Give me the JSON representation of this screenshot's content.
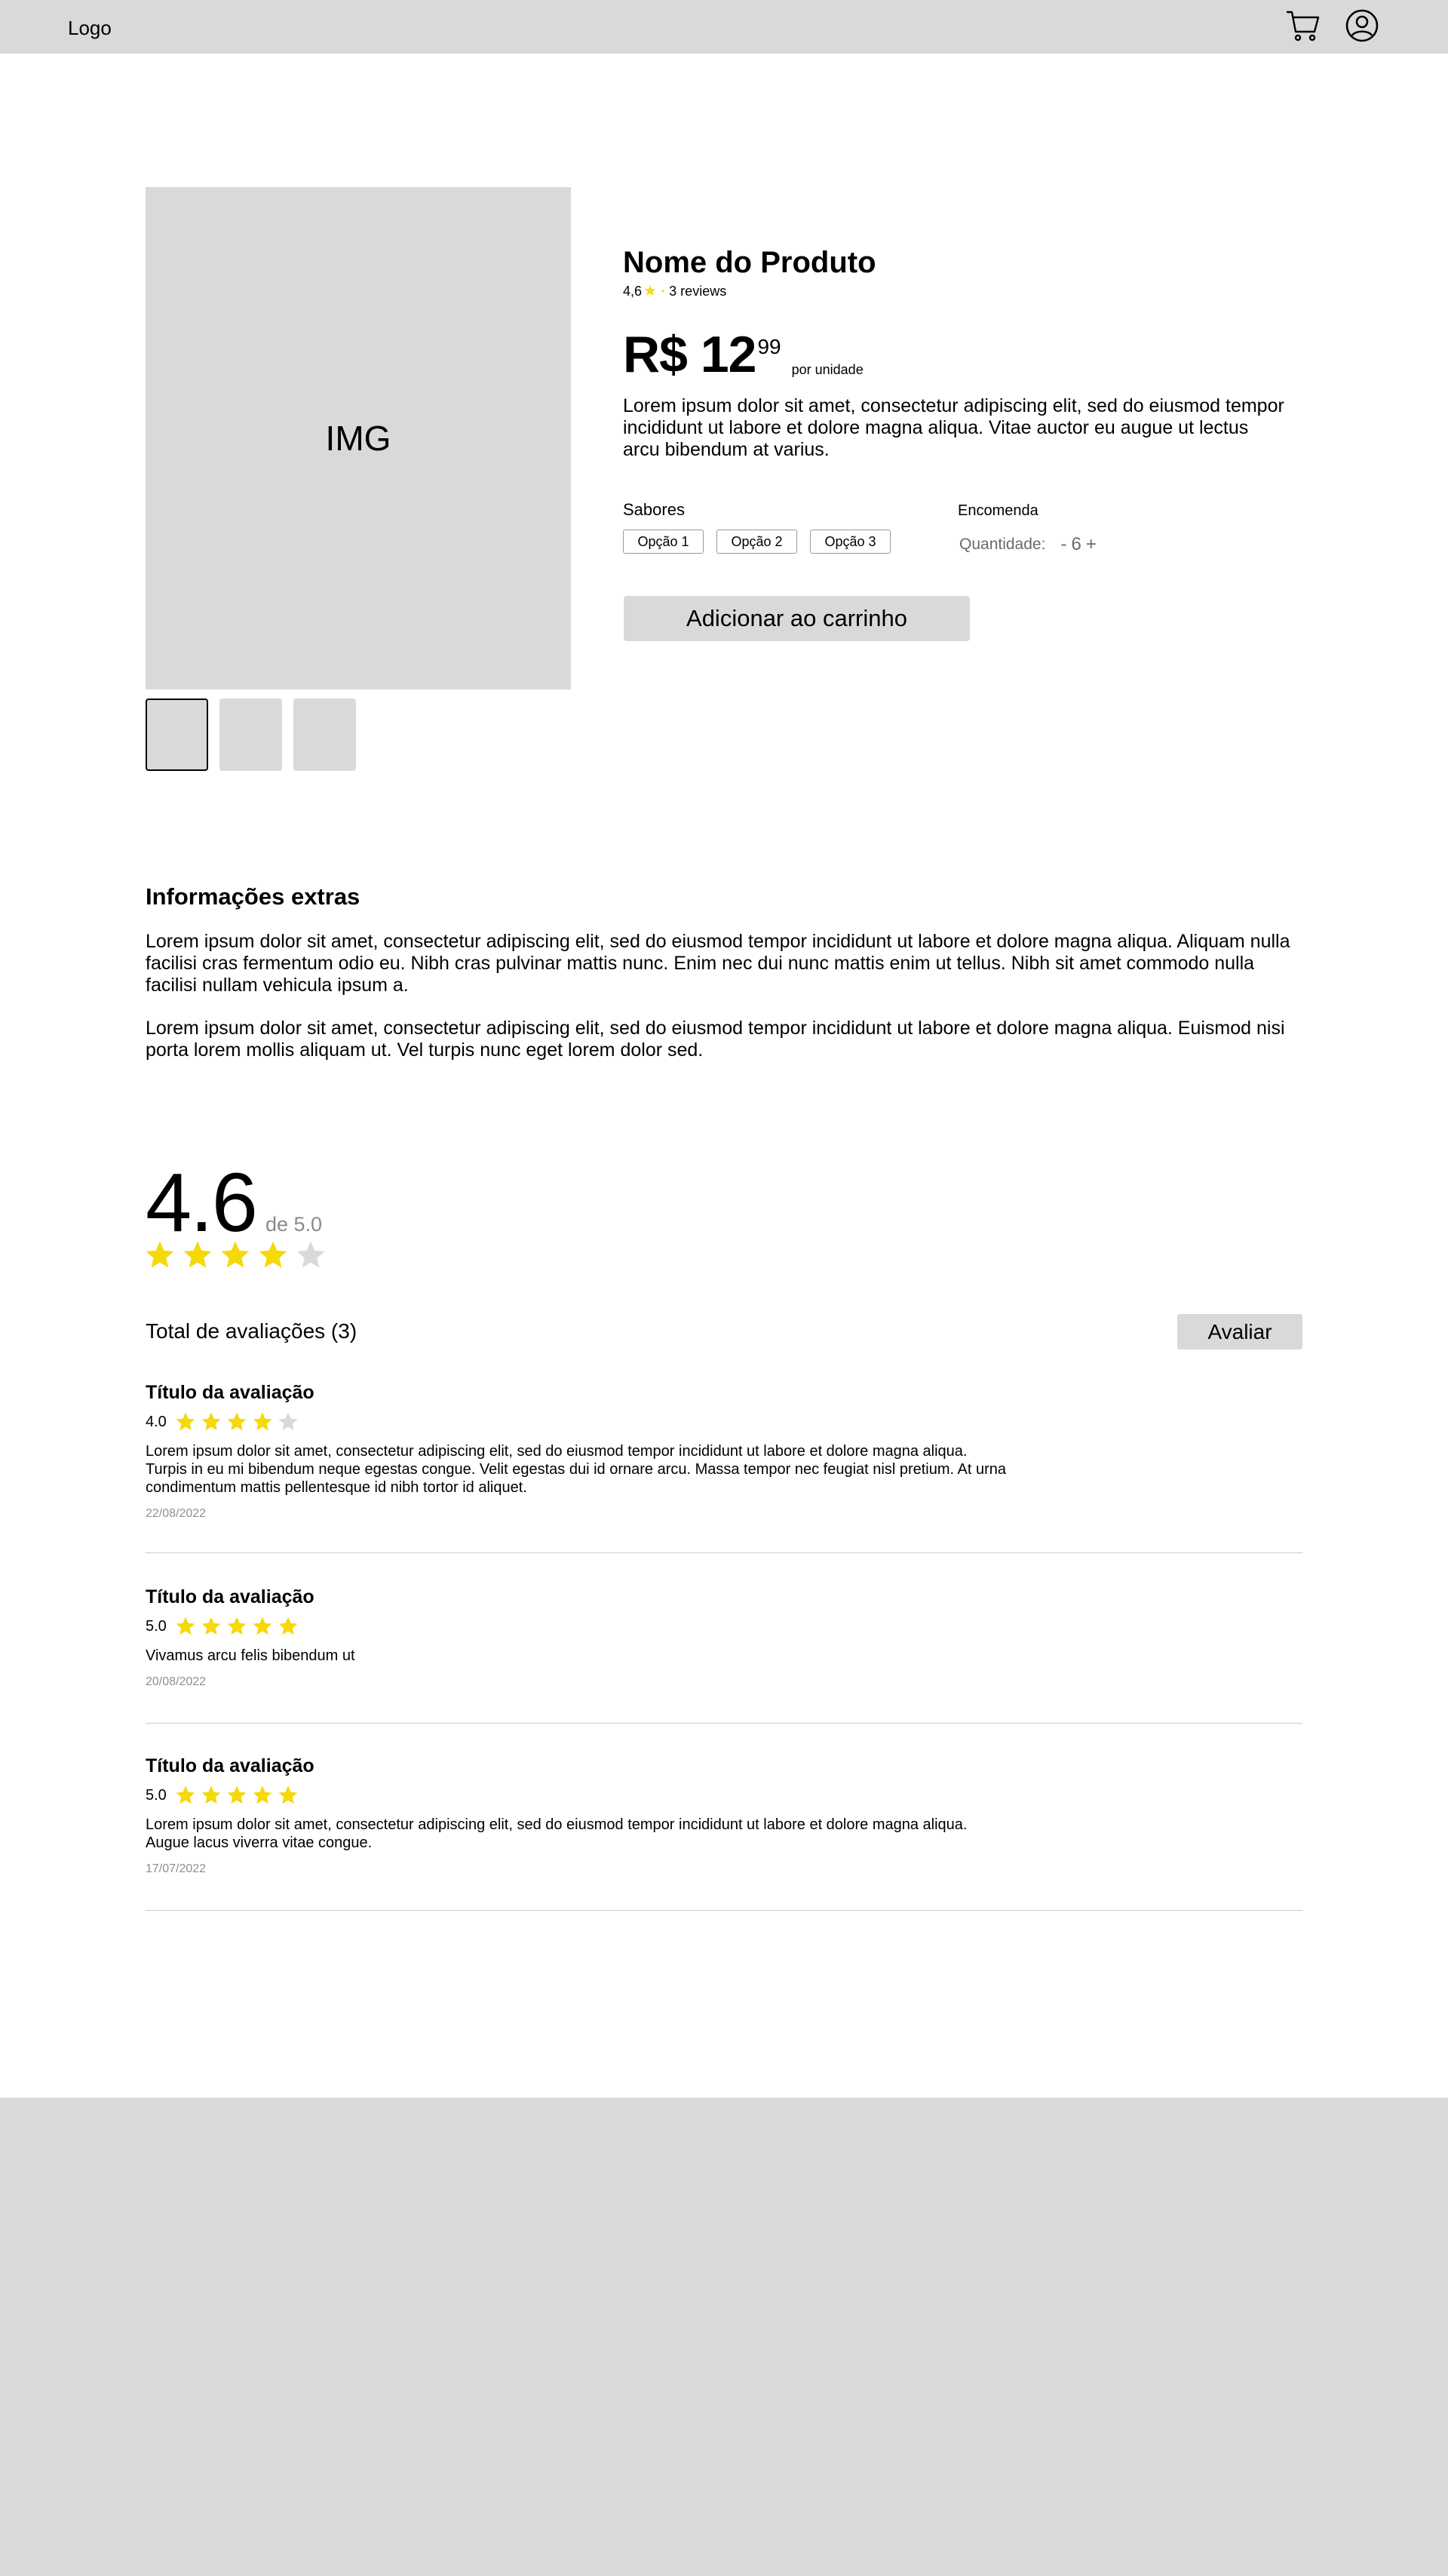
{
  "header": {
    "logo": "Logo",
    "cart_icon": "shopping-cart-icon",
    "user_icon": "user-circle-icon"
  },
  "gallery": {
    "main_label": "IMG",
    "thumbnails": 3,
    "active_index": 0
  },
  "product": {
    "title": "Nome do Produto",
    "rating": "4,6",
    "reviews_count": "3 reviews",
    "price_main": "R$ 12",
    "price_cents": "99",
    "price_unit": "por unidade",
    "description": "Lorem ipsum dolor sit amet, consectetur adipiscing elit, sed do eiusmod tempor incididunt ut labore et dolore magna aliqua. Vitae auctor eu augue ut lectus arcu bibendum at varius.",
    "flavors_label": "Sabores",
    "flavor_options": [
      "Opção 1",
      "Opção 2",
      "Opção 3"
    ],
    "order_label": "Encomenda",
    "quantity_label": "Quantidade:",
    "quantity_minus": "-",
    "quantity_value": "6",
    "quantity_plus": "+",
    "add_to_cart": "Adicionar ao carrinho"
  },
  "extra_info": {
    "title": "Informações extras",
    "paragraph_1": "Lorem ipsum dolor sit amet, consectetur adipiscing elit, sed do eiusmod tempor incididunt ut labore et dolore magna aliqua. Aliquam nulla facilisi cras fermentum odio eu. Nibh cras pulvinar mattis nunc. Enim nec dui nunc mattis enim ut tellus. Nibh sit amet commodo nulla facilisi nullam vehicula ipsum a.",
    "paragraph_2": "Lorem ipsum dolor sit amet, consectetur adipiscing elit, sed do eiusmod tempor incididunt ut labore et dolore magna aliqua. Euismod nisi porta lorem mollis aliquam ut. Vel turpis nunc eget lorem dolor sed."
  },
  "ratings_summary": {
    "average": "4.6",
    "out_of": "de 5.0",
    "stars_filled": 4,
    "stars_total": 5,
    "total_label": "Total de avaliações (3)",
    "rate_button": "Avaliar"
  },
  "reviews": [
    {
      "title": "Título da avaliação",
      "score": "4.0",
      "stars_filled": 4,
      "text": "Lorem ipsum dolor sit amet, consectetur adipiscing elit, sed do eiusmod tempor incididunt ut labore et dolore magna aliqua.\nTurpis in eu mi bibendum neque egestas congue. Velit egestas dui id ornare arcu. Massa tempor nec feugiat nisl pretium. At urna\ncondimentum mattis pellentesque id nibh tortor id aliquet.",
      "date": "22/08/2022"
    },
    {
      "title": "Título da avaliação",
      "score": "5.0",
      "stars_filled": 5,
      "text": "Vivamus arcu felis bibendum ut",
      "date": "20/08/2022"
    },
    {
      "title": "Título da avaliação",
      "score": "5.0",
      "stars_filled": 5,
      "text": "Lorem ipsum dolor sit amet, consectetur adipiscing elit, sed do eiusmod tempor incididunt ut labore et dolore magna aliqua.\nAugue lacus viverra vitae congue.",
      "date": "17/07/2022"
    }
  ],
  "colors": {
    "star_filled": "#f5d90a",
    "star_empty": "#d9d9d9",
    "header_bg": "#d9d9d9",
    "footer_bg": "#d9d9d9"
  }
}
